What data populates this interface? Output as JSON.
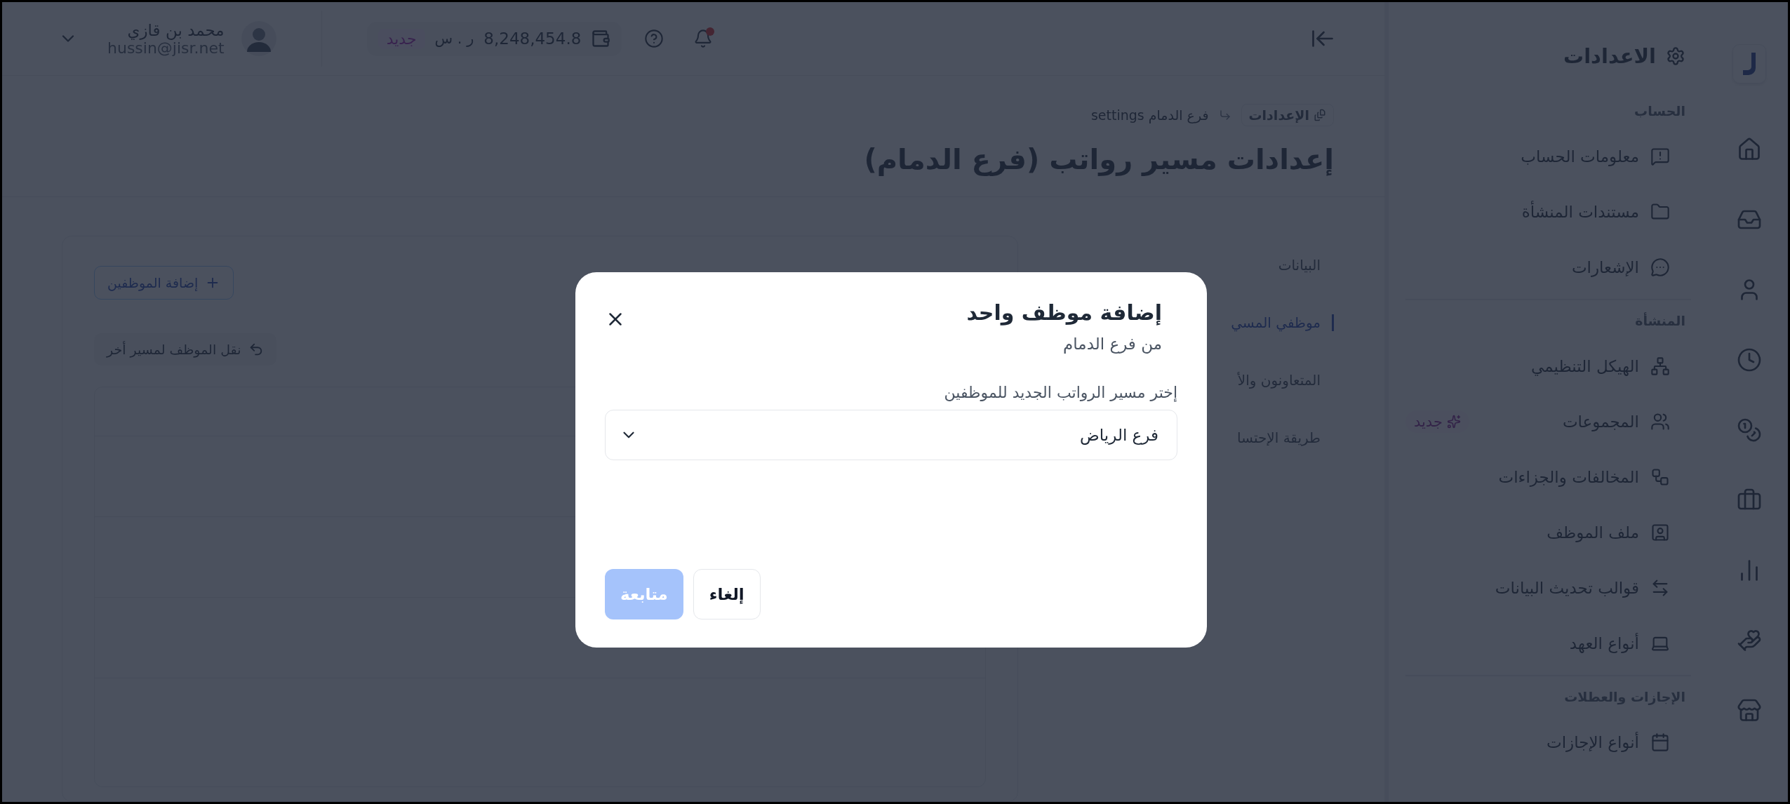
{
  "topbar": {
    "notifications": {
      "unread": true
    },
    "wallet": {
      "balance": "8,248,454.8",
      "currency": "ر . س",
      "badge": "جديد"
    },
    "user": {
      "name": "محمد بن قازي",
      "email": "hussin@jisr.net"
    }
  },
  "breadcrumb": [
    {
      "kind": "chip",
      "label": "الإعدادات"
    },
    {
      "kind": "text",
      "label": "فرع الدمام settings"
    }
  ],
  "page_title": "إعدادات مسير رواتب (فرع الدمام)",
  "actions": [
    {
      "kind": "outline",
      "label": "إضافة الموظفين"
    },
    {
      "kind": "ghost",
      "label": "نقل الموظف لمسير أخر"
    }
  ],
  "section_tabs": [
    {
      "label": "البيانات",
      "selected": false
    },
    {
      "label": "موظفي المسي",
      "selected": true
    },
    {
      "label": "المتعاونون والأ",
      "selected": false
    },
    {
      "label": "طريقة الإحتسا",
      "selected": false
    }
  ],
  "modal": {
    "title": "إضافة موظف واحد",
    "subtitle": "من فرع الدمام",
    "field_label": "إختر مسير الرواتب الجديد للموظفين",
    "select_value": "فرع الرياض",
    "buttons": [
      {
        "kind": "secondary",
        "label": "إلغاء",
        "disabled": false
      },
      {
        "kind": "primary",
        "label": "متابعة",
        "disabled": true
      }
    ]
  },
  "settings_nav": {
    "title": "الاعدادات",
    "groups": [
      {
        "title": "الحساب",
        "items": [
          {
            "label": "معلومات الحساب"
          },
          {
            "label": "مستندات المنشأة"
          },
          {
            "label": "الإشعارات"
          }
        ]
      },
      {
        "title": "المنشأة",
        "items": [
          {
            "label": "الهيكل التنظيمي"
          },
          {
            "label": "المجموعات",
            "badge": "جديد"
          },
          {
            "label": "المخالفات والجزاءات"
          },
          {
            "label": "ملف الموظف"
          },
          {
            "label": "قوالب تحديث البيانات"
          },
          {
            "label": "أنواع العهد"
          }
        ]
      },
      {
        "title": "الإجازات والعطلات",
        "items": [
          {
            "label": "أنواع الإجازات"
          }
        ]
      }
    ]
  }
}
